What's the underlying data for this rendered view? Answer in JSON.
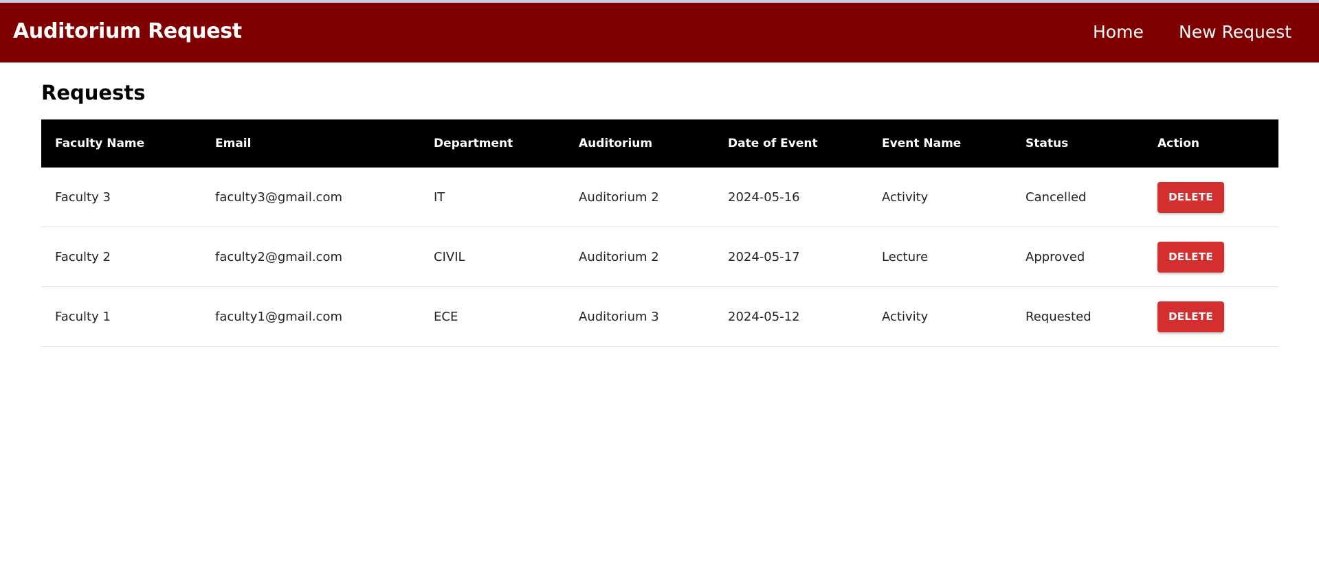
{
  "navbar": {
    "title": "Auditorium Request",
    "links": [
      "Home",
      "New Request"
    ],
    "background": "#800000"
  },
  "page": {
    "title": "Requests"
  },
  "table": {
    "headers": [
      "Faculty Name",
      "Email",
      "Department",
      "Auditorium",
      "Date of Event",
      "Event Name",
      "Status",
      "Action"
    ],
    "rows": [
      {
        "faculty_name": "Faculty 3",
        "email": "faculty3@gmail.com",
        "department": "IT",
        "auditorium": "Auditorium 2",
        "date": "2024-05-16",
        "event_name": "Activity",
        "status": "Cancelled",
        "action": "DELETE"
      },
      {
        "faculty_name": "Faculty 2",
        "email": "faculty2@gmail.com",
        "department": "CIVIL",
        "auditorium": "Auditorium 2",
        "date": "2024-05-17",
        "event_name": "Lecture",
        "status": "Approved",
        "action": "DELETE"
      },
      {
        "faculty_name": "Faculty 1",
        "email": "faculty1@gmail.com",
        "department": "ECE",
        "auditorium": "Auditorium 3",
        "date": "2024-05-12",
        "event_name": "Activity",
        "status": "Requested",
        "action": "DELETE"
      }
    ],
    "header_background": "#000000",
    "delete_button_color": "#d32f2f"
  }
}
